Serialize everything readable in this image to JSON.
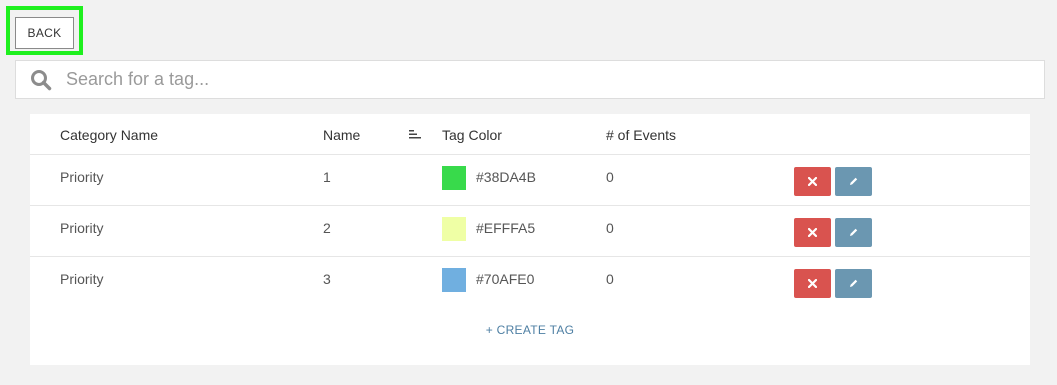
{
  "back_button": {
    "label": "BACK"
  },
  "search": {
    "placeholder": "Search for a tag...",
    "icon": "search-icon"
  },
  "table": {
    "headers": {
      "category": "Category Name",
      "name": "Name",
      "tag_color": "Tag Color",
      "events": "# of Events"
    },
    "rows": [
      {
        "category": "Priority",
        "name": "1",
        "color_hex": "#38DA4B",
        "color": "#38DA4B",
        "events": "0"
      },
      {
        "category": "Priority",
        "name": "2",
        "color_hex": "#EFFFA5",
        "color": "#EFFFA5",
        "events": "0"
      },
      {
        "category": "Priority",
        "name": "3",
        "color_hex": "#70AFE0",
        "color": "#70AFE0",
        "events": "0"
      }
    ]
  },
  "create_tag": {
    "label": "+ CREATE TAG"
  },
  "colors": {
    "highlight": "#1EF01E",
    "delete": "#D9534F",
    "edit": "#6B97B1",
    "link": "#4E7FA3"
  }
}
